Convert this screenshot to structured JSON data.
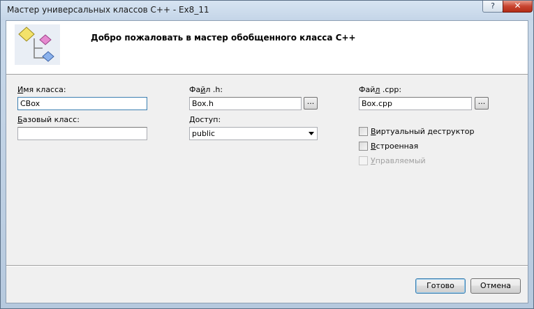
{
  "window": {
    "title": "Мастер универсальных классов C++ - Ex8_11",
    "help_label": "?",
    "close_label": "✕"
  },
  "banner": {
    "title": "Добро пожаловать в мастер обобщенного класса C++",
    "logo_icon": "class-wizard-icon"
  },
  "form": {
    "class_name": {
      "label_hotkey": "И",
      "label_rest": "мя класса:",
      "value": "CBox"
    },
    "base_class": {
      "label_hotkey": "Б",
      "label_rest": "азовый класс:",
      "value": ""
    },
    "h_file": {
      "label_pre": "Фа",
      "label_hotkey": "й",
      "label_rest": "л .h:",
      "value": "Box.h",
      "browse_label": "..."
    },
    "access": {
      "label_hotkey": "Д",
      "label_rest": "оступ:",
      "value": "public"
    },
    "cpp_file": {
      "label_pre": "Фай",
      "label_hotkey": "л",
      "label_rest": " .cpp:",
      "value": "Box.cpp",
      "browse_label": "..."
    },
    "virtual_destructor": {
      "label_hotkey": "В",
      "label_rest": "иртуальный деструктор",
      "checked": false
    },
    "inline": {
      "label_hotkey": "В",
      "label_rest": "строенная",
      "checked": false
    },
    "managed": {
      "label_hotkey": "У",
      "label_rest": "правляемый",
      "checked": false,
      "disabled": true
    }
  },
  "buttons": {
    "finish_label": "Готово",
    "cancel_label": "Отмена"
  },
  "colors": {
    "title_gradient_top": "#d7e4f2",
    "close_red": "#c84430",
    "focus_border": "#3c7fb1"
  }
}
